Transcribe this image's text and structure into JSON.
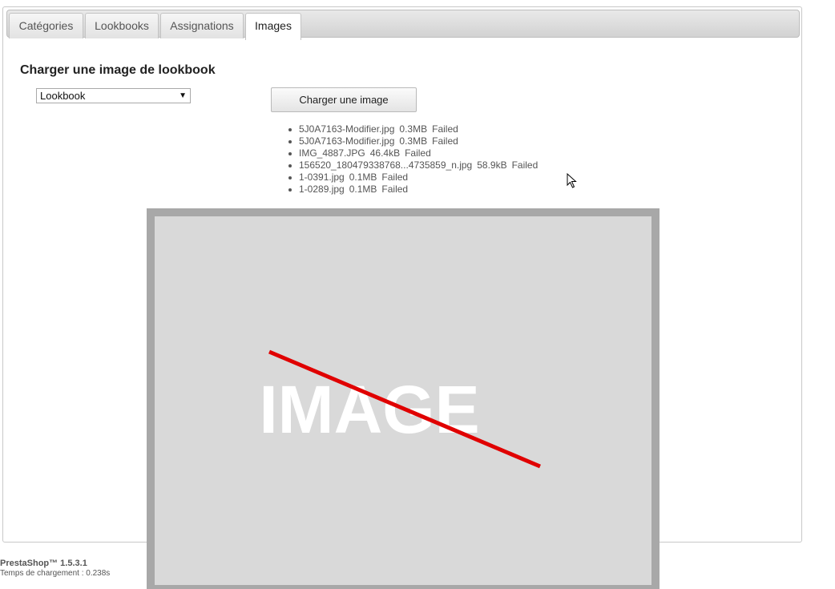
{
  "tabs": [
    {
      "label": "Catégories",
      "active": false
    },
    {
      "label": "Lookbooks",
      "active": false
    },
    {
      "label": "Assignations",
      "active": false
    },
    {
      "label": "Images",
      "active": true
    }
  ],
  "section": {
    "title": "Charger une image de lookbook",
    "select_value": "Lookbook",
    "upload_button": "Charger une image"
  },
  "files": [
    {
      "name": "5J0A7163-Modifier.jpg",
      "size": "0.3MB",
      "status": "Failed"
    },
    {
      "name": "5J0A7163-Modifier.jpg",
      "size": "0.3MB",
      "status": "Failed"
    },
    {
      "name": "IMG_4887.JPG",
      "size": "46.4kB",
      "status": "Failed"
    },
    {
      "name": "156520_180479338768...4735859_n.jpg",
      "size": "58.9kB",
      "status": "Failed"
    },
    {
      "name": "1-0391.jpg",
      "size": "0.1MB",
      "status": "Failed"
    },
    {
      "name": "1-0289.jpg",
      "size": "0.1MB",
      "status": "Failed"
    }
  ],
  "image_placeholder": {
    "text": "IMAGE",
    "strike_color": "#e00000"
  },
  "footer": {
    "brand": "PrestaShop™ 1.5.3.1",
    "load_time": "Temps de chargement : 0.238s"
  },
  "icons": {
    "cursor": "mouse-pointer-icon",
    "dropdown": "triangle-down-icon"
  }
}
